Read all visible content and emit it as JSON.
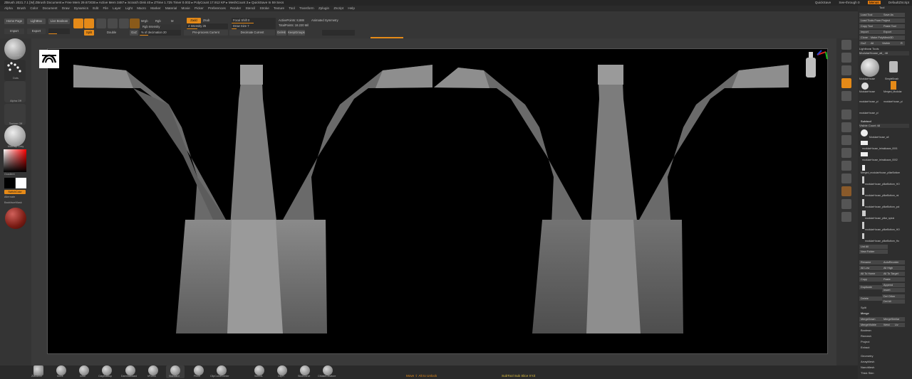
{
  "titlebar": {
    "left": "ZBrush 2021.7.1 [W]   ZBrush Document   ▸ Free Mem 29.673GB ▸ Active Mem 3487 ▸ Scratch Disk 40 ▸ ZTime 1.725 Timer 0.002 ▸ PolyCount 17.912 KP ▸ MeshCount 3 ▸ QuickSave In 59 Secs",
    "quicksave": "QuickSave",
    "seethrough": "See-through  0",
    "menus": "Menus",
    "script": "DefaultZScript"
  },
  "menubar": [
    "Alpha",
    "Brush",
    "Color",
    "Document",
    "Draw",
    "Dynamics",
    "Edit",
    "File",
    "Layer",
    "Light",
    "Macro",
    "Marker",
    "Material",
    "Movie",
    "Picker",
    "Preferences",
    "Render",
    "Stencil",
    "Stroke",
    "Texture",
    "Tool",
    "Transform",
    "Zplugin",
    "Zscript",
    "Help"
  ],
  "topshelf": {
    "home_page": "Home Page",
    "lightbox": "LightBox",
    "live_boolean": "Live Boolean",
    "import": "Import",
    "export": "Export",
    "edit": "Edit",
    "draw": "Draw",
    "move": "Move",
    "scale": "Scale",
    "rotate": "Rotate",
    "mrgb": "Mrgb",
    "rgb": "Rgb",
    "m": "M",
    "zadd": "Zadd",
    "zsub": "Zsub",
    "rgb_intensity": "Rgb Intensity",
    "z_intensity": "Z Intensity  25",
    "focal_shift": "Focal Shift  0",
    "draw_size": "Draw Size  7",
    "active_points": "ActivePoints: 8,888",
    "total_points": "TotalPoints: 18.220 Mil",
    "animated_symmetry": "Animated Symmetry",
    "split": "Split",
    "double": "Double",
    "gz": "GxZ",
    "pct_decimation": "% of decimation  20",
    "preprocess": "Pre-process Current",
    "decimate": "Decimate Current",
    "delhidden": "DelHit",
    "keepgroups": "KeepGroups"
  },
  "leftpanel": {
    "brush": "Standard",
    "stroke": "Dots",
    "alpha": "Alpha Off",
    "texture": "Texture Off",
    "material": "MatCap Gray",
    "gradient": "Gradient",
    "switch_color": "SwitchColor",
    "alternate": "Alternate",
    "backface": "BackfaceMask"
  },
  "rightdock": [
    "BPR",
    "SPix 3",
    "Persp",
    "Floor",
    "Local",
    "L.Sym",
    "Frame",
    "Move",
    "Zoom3D",
    "Rotate",
    "Line Fill",
    "Transp",
    "Ghost",
    "Solo",
    "Xpose"
  ],
  "tool": {
    "header": "Tool",
    "load_tool": "Load Tool",
    "save_as": "Save As",
    "load_from_project": "Load Tools From Project",
    "copy_tool": "Copy Tool",
    "paste_tool": "Paste Tool",
    "import": "Import",
    "export": "Export",
    "clone": "Clone",
    "make_polymesh": "Make PolyMesh3D",
    "goz": "GoZ",
    "all": "All",
    "visible": "Visible",
    "r": "R",
    "lightbox_tools": "Lightbox▸ Tools",
    "current_tool": "ModularHouse_all_  48",
    "tool_thumbs": [
      "ModularHouse",
      "Cylinder3D",
      "SimpleBrush",
      "ModularHouse",
      "Merged_Modular",
      "modularHouse_pi",
      "modularHouse_pi",
      "modularHouse_pi"
    ],
    "subtool_header": "Subtool",
    "visible_count": "Visible Count  48",
    "subtools": [
      "ModularHouse_all",
      "modularHouse_tetrakkawa_0001",
      "modularHouse_tetrakkawa_0002",
      "Merged_modularHouse_pillarBottom",
      "modularHouse_pillarBottom_HO",
      "modularHouse_pillarBottom_mi",
      "modularHouse_pillarBottom_pol",
      "modularHouse_pillar_spiral",
      "modularHouse_pillarBottom_HO",
      "modularHouse_pillarBottom_Ho"
    ],
    "list_all": "List All",
    "new_folder": "New Folder",
    "rename": "Rename",
    "autoreorder": "AutoReorder",
    "all_low": "All Low",
    "all_high": "All High",
    "all_to_home": "All To Home",
    "all_to_target": "All To Target",
    "copy": "Copy",
    "paste": "Paste",
    "duplicate": "Duplicate",
    "append": "Append",
    "insert": "Insert",
    "delete": "Delete",
    "del_other": "Del Other",
    "del_all": "Del All",
    "split": "Split",
    "merge": "Merge",
    "merge_down": "MergeDown",
    "merge_similar": "MergeSimilar",
    "merge_visible": "MergeVisible",
    "weld": "Weld",
    "uv": "Uv",
    "boolean": "Boolean",
    "remesh": "Remesh",
    "project": "Project",
    "extract": "Extract",
    "geometry": "Geometry",
    "arraymesh": "ArrayMesh",
    "nanomesh": "NanoMesh",
    "thick_skin": "Thick Skin"
  },
  "bottombar": {
    "brushes": [
      "ZModeler",
      "Move",
      "Inflat",
      "ClayBuildup",
      "DamStandard",
      "hPolish",
      "Standard",
      "Pinch",
      "ClipCurveCenter",
      "SelectL",
      "ClipR",
      "SliceCurve",
      "CMakeCreature"
    ],
    "hint": "Move ⇧ Alt to Unlock",
    "status": "SubTool Sub Slice XYZ"
  }
}
